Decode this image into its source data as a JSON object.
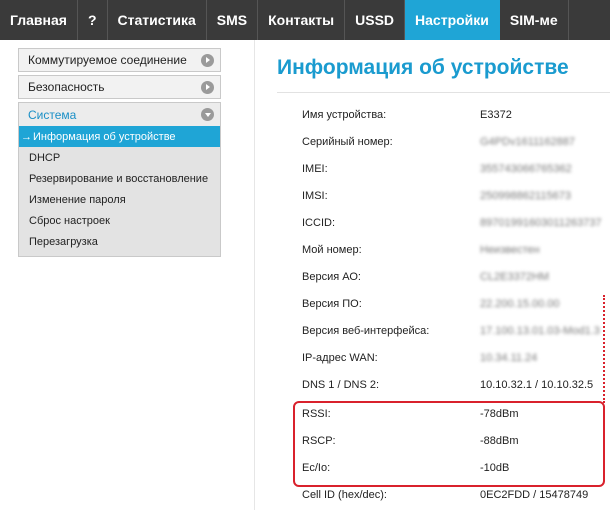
{
  "topnav": {
    "tabs": [
      {
        "label": "Главная",
        "active": false
      },
      {
        "label": "?",
        "active": false
      },
      {
        "label": "Статистика",
        "active": false
      },
      {
        "label": "SMS",
        "active": false
      },
      {
        "label": "Контакты",
        "active": false
      },
      {
        "label": "USSD",
        "active": false
      },
      {
        "label": "Настройки",
        "active": true
      },
      {
        "label": "SIM-ме",
        "active": false
      }
    ]
  },
  "sidebar": {
    "sections": [
      {
        "label": "Коммутируемое соединение"
      },
      {
        "label": "Безопасность"
      },
      {
        "label": "Система"
      }
    ],
    "system_items": [
      {
        "label": "Информация об устройстве",
        "active": true
      },
      {
        "label": "DHCP"
      },
      {
        "label": "Резервирование и восстановление"
      },
      {
        "label": "Изменение пароля"
      },
      {
        "label": "Сброс настроек"
      },
      {
        "label": "Перезагрузка"
      }
    ],
    "active_marker": "→"
  },
  "main": {
    "title": "Информация об устройстве",
    "rows": [
      {
        "label": "Имя устройства:",
        "value": "E3372"
      },
      {
        "label": "Серийный номер:",
        "value": "G4PDv1611162887"
      },
      {
        "label": "IMEI:",
        "value": "355743066765362"
      },
      {
        "label": "IMSI:",
        "value": "250998862115673"
      },
      {
        "label": "ICCID:",
        "value": "89701991603011263737"
      },
      {
        "label": "Мой номер:",
        "value": "Неизвестен"
      },
      {
        "label": "Версия АО:",
        "value": "CL2E3372HM"
      },
      {
        "label": "Версия ПО:",
        "value": "22.200.15.00.00"
      },
      {
        "label": "Версия веб-интерфейса:",
        "value": "17.100.13.01.03-Mod1.3"
      },
      {
        "label": "IP-адрес WAN:",
        "value": "10.34.11.24"
      },
      {
        "label": "DNS 1 / DNS 2:",
        "value": "10.10.32.1 / 10.10.32.5"
      },
      {
        "label": "RSSI:",
        "value": "-78dBm"
      },
      {
        "label": "RSCP:",
        "value": "-88dBm"
      },
      {
        "label": "Ec/Io:",
        "value": "-10dB"
      },
      {
        "label": "Cell ID (hex/dec):",
        "value": "0EC2FDD / 15478749"
      }
    ]
  },
  "colors": {
    "accent": "#1fa5d6",
    "title": "#1a9bcf",
    "nav_bg": "#3a3a3a",
    "highlight": "#d9212c"
  }
}
